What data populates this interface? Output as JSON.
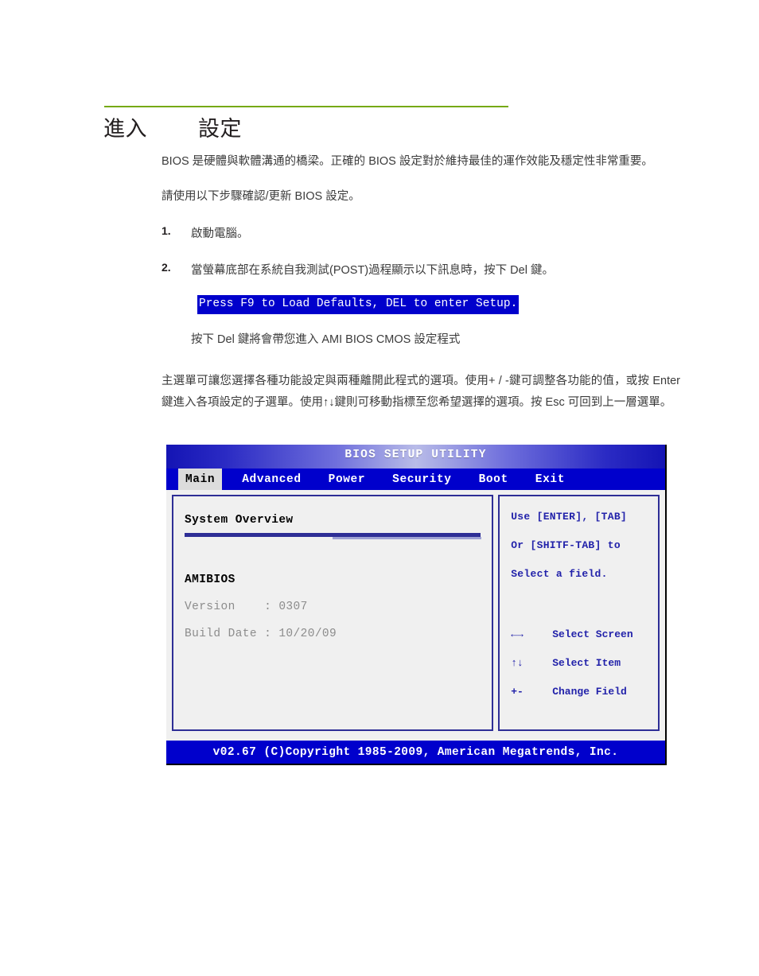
{
  "document": {
    "title": "進入        設定",
    "rule_color": "#76a914",
    "paragraphs": {
      "intro": "BIOS 是硬體與軟體溝通的橋梁。正確的 BIOS 設定對於維持最佳的運作效能及穩定性非常重要。",
      "steps_lead": "請使用以下步驟確認/更新 BIOS 設定。",
      "after_post": "按下 Del 鍵將會帶您進入 AMI BIOS CMOS 設定程式",
      "main_menu": "主選單可讓您選擇各種功能設定與兩種離開此程式的選項。使用+ / -鍵可調整各功能的值，或按 Enter 鍵進入各項設定的子選單。使用↑↓鍵則可移動指標至您希望選擇的選項。按 Esc 可回到上一層選單。"
    },
    "steps": [
      {
        "number": "1.",
        "text": "啟動電腦。"
      },
      {
        "number": "2.",
        "text": "當螢幕底部在系統自我測試(POST)過程顯示以下訊息時，按下 Del 鍵。"
      }
    ],
    "post_message": "Press F9 to Load Defaults, DEL to enter Setup."
  },
  "bios": {
    "title": "BIOS SETUP UTILITY",
    "tabs": [
      {
        "label": "Main",
        "active": true
      },
      {
        "label": "Advanced",
        "active": false
      },
      {
        "label": "Power",
        "active": false
      },
      {
        "label": "Security",
        "active": false
      },
      {
        "label": "Boot",
        "active": false
      },
      {
        "label": "Exit",
        "active": false
      }
    ],
    "main_panel": {
      "section_title": "System Overview",
      "group_title": "AMIBIOS",
      "rows": [
        {
          "label": "Version",
          "separator": ":",
          "value": "0307",
          "text": "Version    : 0307"
        },
        {
          "label": "Build Date",
          "separator": ":",
          "value": "10/20/09",
          "text": "Build Date : 10/20/09"
        }
      ]
    },
    "help_panel": {
      "lines": [
        "Use [ENTER], [TAB]",
        "Or [SHITF-TAB] to",
        "Select a field."
      ],
      "legend": [
        {
          "key": "←→",
          "desc": "Select Screen"
        },
        {
          "key": "↑↓",
          "desc": "Select Item"
        },
        {
          "key": "+-",
          "desc": "Change Field"
        }
      ]
    },
    "footer": "v02.67 (C)Copyright 1985-2009, American Megatrends, Inc.",
    "colors": {
      "blue": "#0000cc",
      "navy": "#2e2e96",
      "help_text": "#2222aa",
      "panel_bg": "#f0f0f0",
      "active_tab_bg": "#dcdcdc"
    }
  }
}
